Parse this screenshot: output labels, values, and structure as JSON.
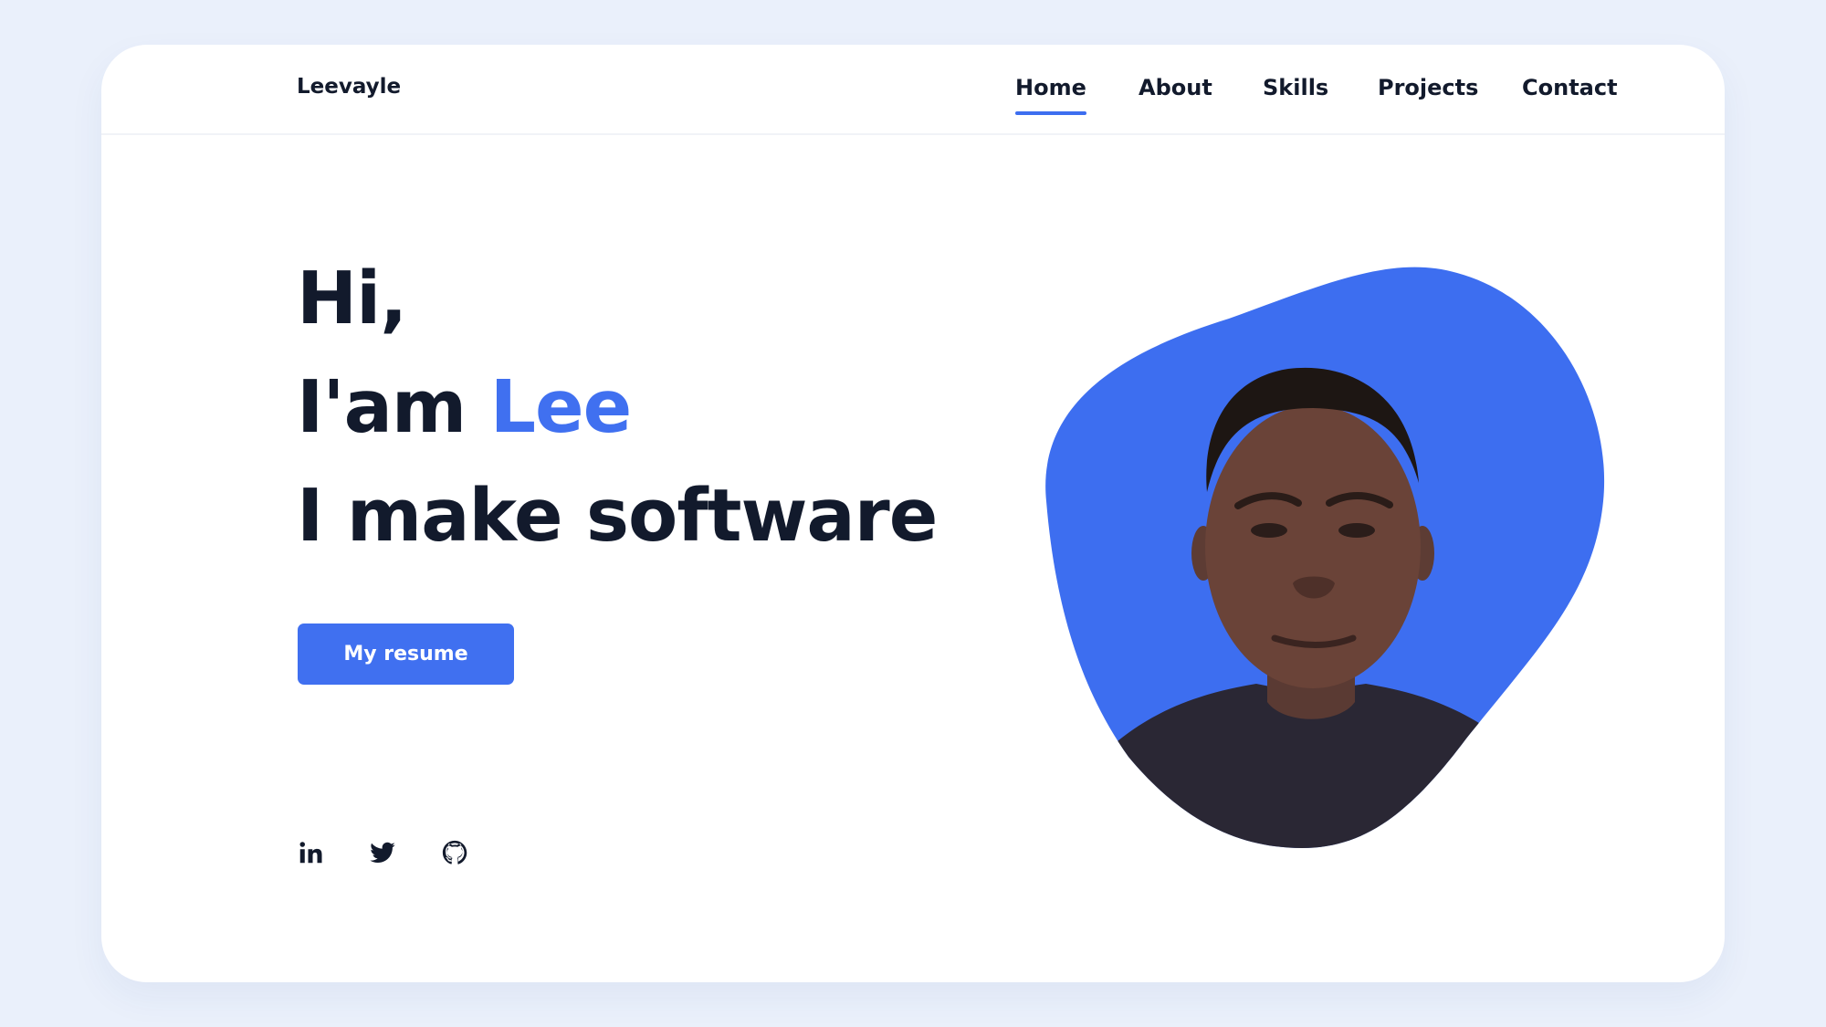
{
  "brand": {
    "name": "Leevayle"
  },
  "nav": {
    "items": [
      {
        "label": "Home",
        "active": true
      },
      {
        "label": "About"
      },
      {
        "label": "Skills"
      },
      {
        "label": "Projects"
      },
      {
        "label": "Contact"
      }
    ]
  },
  "hero": {
    "greeting": "Hi,",
    "intro_prefix": "I'am ",
    "name": "Lee",
    "tagline": "I make software",
    "cta_label": "My resume"
  },
  "social": {
    "icons": [
      "linkedin-icon",
      "twitter-icon",
      "github-icon"
    ]
  },
  "colors": {
    "accent": "#4070f0",
    "text": "#121a2c",
    "background": "#eaf0fb",
    "card": "#ffffff"
  }
}
